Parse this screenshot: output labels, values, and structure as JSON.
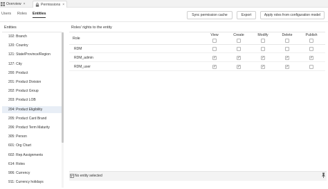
{
  "window_tabs": [
    {
      "label": "Overview",
      "close": "×",
      "icon": "grid-icon"
    },
    {
      "label": "Permissions",
      "close": "×",
      "icon": "lock-icon"
    }
  ],
  "sub_tabs": [
    {
      "label": "Users"
    },
    {
      "label": "Roles"
    },
    {
      "label": "Entities"
    }
  ],
  "actions": {
    "sync": "Sync permission cache",
    "export": "Export",
    "apply": "Apply roles from configuration model"
  },
  "left_panel": {
    "title": "Entities",
    "items": [
      "102: Branch",
      "120: Country",
      "121: State/Province/Region",
      "127: City",
      "200: Product",
      "201: Product Division",
      "202: Product Group",
      "203: Product LOB",
      "204: Product Eligibility",
      "205: Product Card Brand",
      "206: Product Term Maturity",
      "305: Person",
      "601: Org Chart",
      "602: Rep Assignments",
      "614: Roles",
      "906: Currency",
      "911: Currency holidays"
    ],
    "selected_index": 8
  },
  "right_panel": {
    "title": "Roles' rights to the entity",
    "role_header": "Role",
    "columns": [
      "View",
      "Create",
      "Modify",
      "Delete",
      "Publish"
    ],
    "rows": [
      {
        "role": "RDM",
        "rights": [
          false,
          false,
          false,
          false,
          false
        ]
      },
      {
        "role": "RDM_admin",
        "rights": [
          true,
          true,
          true,
          true,
          true
        ]
      },
      {
        "role": "RDM_user",
        "rights": [
          true,
          true,
          true,
          true,
          false
        ]
      }
    ],
    "check_glyph": "✓"
  },
  "footer": {
    "status": "No entity selected"
  }
}
